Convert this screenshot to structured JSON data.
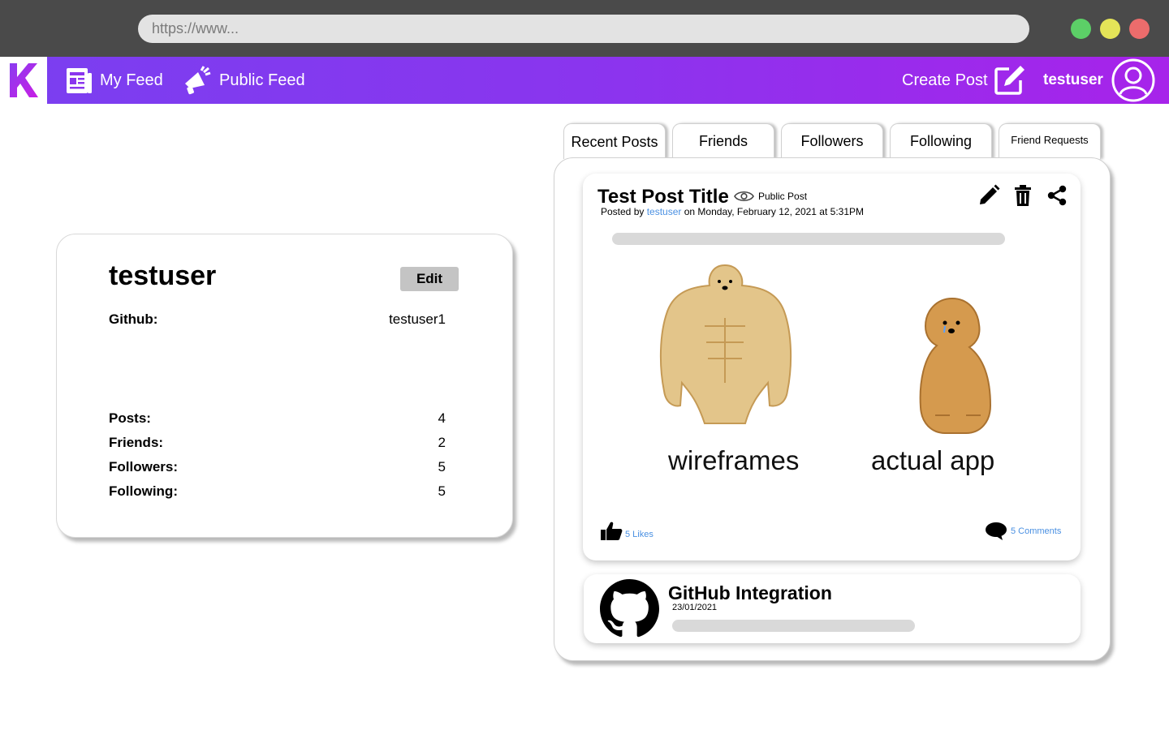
{
  "browser": {
    "url_placeholder": "https://www...",
    "colors": {
      "close": "#ec6c6c",
      "minimize": "#e4e458",
      "maximize": "#5ccf67"
    }
  },
  "nav": {
    "logo_letter": "K",
    "brand_color": "#8a35ee",
    "items": [
      {
        "label": "My Feed",
        "icon": "newspaper-icon"
      },
      {
        "label": "Public Feed",
        "icon": "megaphone-icon"
      }
    ],
    "create_post_label": "Create Post",
    "username": "testuser"
  },
  "profile": {
    "name": "testuser",
    "edit_label": "Edit",
    "github_label": "Github:",
    "github_value": "testuser1",
    "stats": [
      {
        "label": "Posts:",
        "value": "4"
      },
      {
        "label": "Friends:",
        "value": "2"
      },
      {
        "label": "Followers:",
        "value": "5"
      },
      {
        "label": "Following:",
        "value": "5"
      }
    ]
  },
  "tabs": [
    {
      "label": "Recent Posts"
    },
    {
      "label": "Friends"
    },
    {
      "label": "Followers"
    },
    {
      "label": "Following"
    },
    {
      "label": "Friend Requests"
    }
  ],
  "post": {
    "title": "Test Post Title",
    "visibility": "Public Post",
    "meta_prefix": "Posted by",
    "author": "testuser",
    "meta_suffix": "on Monday, February 12, 2021 at 5:31PM",
    "meme_left_caption": "wireframes",
    "meme_right_caption": "actual app",
    "likes": "5 Likes",
    "comments": "5 Comments"
  },
  "github_post": {
    "title": "GitHub Integration",
    "date": "23/01/2021"
  }
}
